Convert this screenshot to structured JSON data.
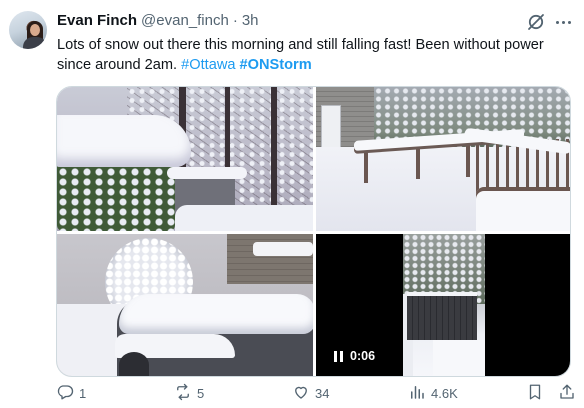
{
  "tweet": {
    "author_name": "Evan Finch",
    "author_handle": "@evan_finch",
    "separator": "·",
    "time": "3h",
    "text_part1": "Lots of snow out there this morning and still falling fast! Been without power since around 2am. ",
    "hashtag1": "#Ottawa",
    "hashtag2": "#ONStorm"
  },
  "media": {
    "video_duration": "0:06"
  },
  "actions": {
    "replies": "1",
    "reposts": "5",
    "likes": "34",
    "views": "4.6K"
  },
  "icons": {
    "grok": "grok-icon",
    "more": "more-icon",
    "reply": "reply-icon",
    "repost": "repost-icon",
    "like": "heart-icon",
    "views": "views-icon",
    "bookmark": "bookmark-icon",
    "share": "share-icon",
    "pause": "pause-icon"
  },
  "colors": {
    "link": "#1d9bf0",
    "secondary_text": "#536471",
    "primary_text": "#0f1419"
  }
}
